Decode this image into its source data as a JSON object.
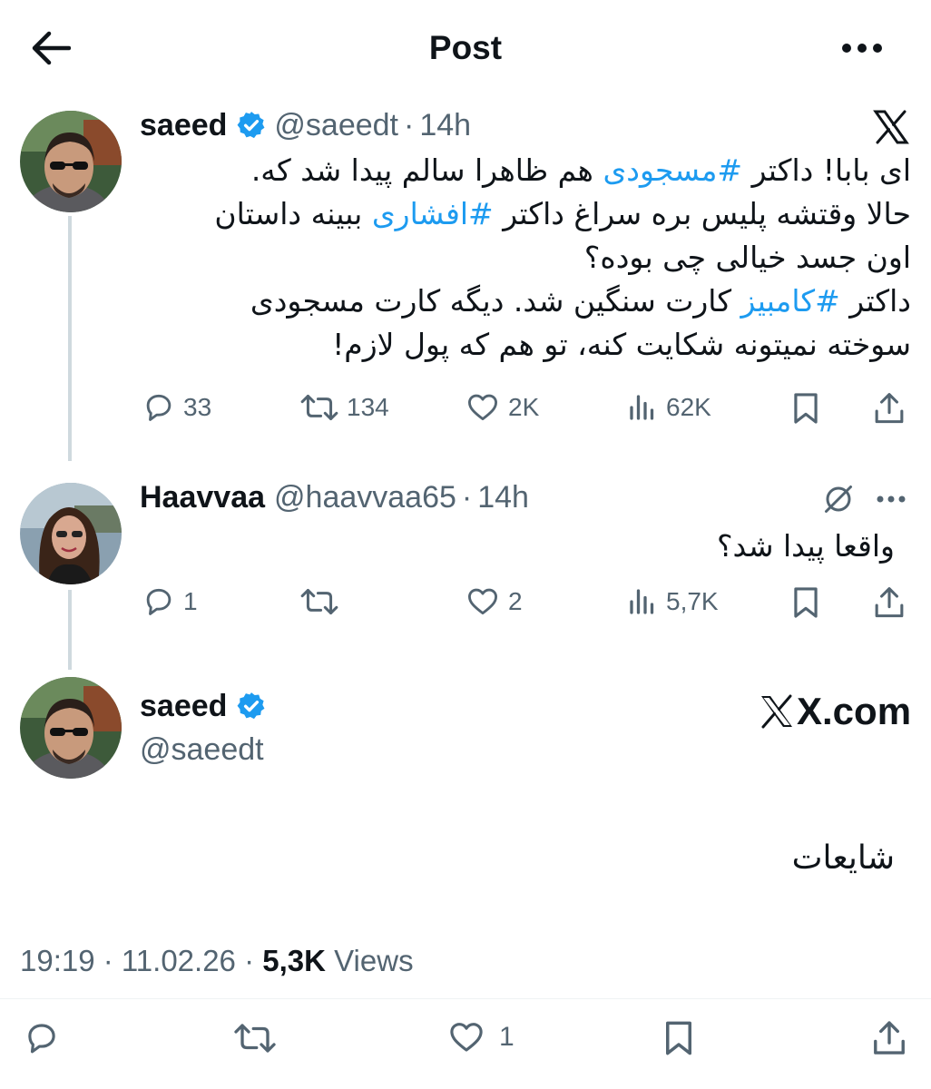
{
  "header": {
    "title": "Post"
  },
  "post1": {
    "name": "saeed",
    "handle": "@saeedt",
    "separator": "·",
    "time": "14h",
    "lines": [
      [
        "ای بابا! داکتر ",
        "#مسجودی",
        " هم ظاهرا سالم پیدا شد که."
      ],
      [
        "حالا وقتشه پلیس بره سراغ داکتر ",
        "#افشاری",
        " ببینه داستان"
      ],
      [
        "اون جسد خیالی چی بوده؟",
        "",
        ""
      ],
      [
        "داکتر ",
        "#کامبیز",
        " کارت سنگین شد. دیگه کارت مسجودی"
      ],
      [
        "سوخته نمیتونه شکایت کنه، تو هم که پول لازم!",
        "",
        ""
      ]
    ],
    "stats": {
      "replies": "33",
      "reposts": "134",
      "likes": "2K",
      "views": "62K"
    }
  },
  "post2": {
    "name": "Haavvaa",
    "handle": "@haavvaa65",
    "separator": "·",
    "time": "14h",
    "text": "واقعا پیدا شد؟",
    "stats": {
      "replies": "1",
      "reposts": "",
      "likes": "2",
      "views": "5,7K"
    }
  },
  "post3": {
    "name": "saeed",
    "handle": "@saeedt",
    "brand": "X.com",
    "text": "شایعات",
    "date_time": "19:19 · 11.02.26 ·",
    "views_count": "5,3K",
    "views_label": "Views",
    "stats": {
      "replies": "",
      "reposts": "",
      "likes": "1"
    }
  },
  "colors": {
    "accent": "#1d9bf0",
    "secondary_text": "#536471",
    "thread_line": "#cfd9de"
  },
  "icons": [
    "back-arrow-icon",
    "more-horizontal-icon",
    "x-logo-icon",
    "verified-badge-icon",
    "reply-icon",
    "repost-icon",
    "like-icon",
    "views-icon",
    "bookmark-icon",
    "share-icon",
    "grok-icon"
  ]
}
